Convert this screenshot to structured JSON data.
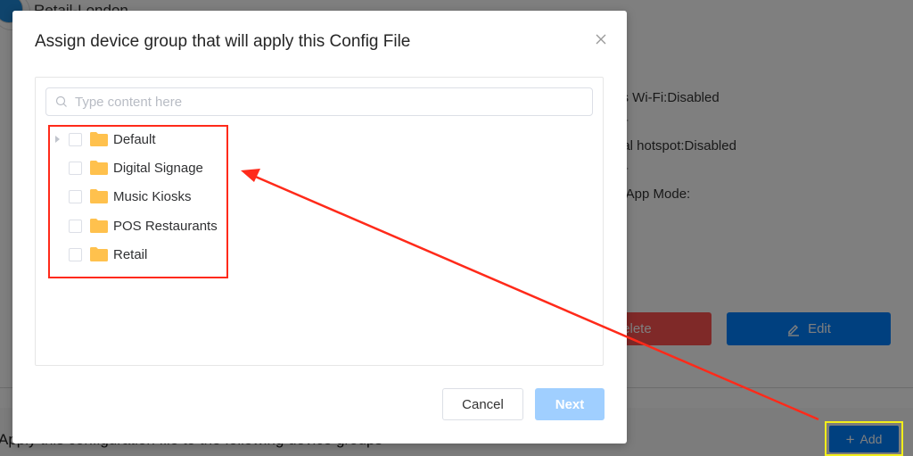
{
  "background_page": {
    "title": "Retail-London",
    "fields": [
      "ss Wi-Fi:Disabled",
      "---",
      "nal hotspot:Disabled",
      "---",
      "e App Mode:"
    ],
    "delete_label": "Delete",
    "edit_label": "Edit",
    "footer_text": "Apply this configuration file to the following device groups",
    "add_label": "Add",
    "colors": {
      "delete": "#ff5350",
      "edit": "#0081ff",
      "add": "#0081ff"
    }
  },
  "modal": {
    "title": "Assign device group that will apply this Config File",
    "search": {
      "placeholder": "Type content here",
      "value": ""
    },
    "tree": [
      {
        "label": "Default",
        "expandable": true,
        "checked": false,
        "icon": "folder-icon"
      },
      {
        "label": "Digital Signage",
        "expandable": false,
        "checked": false,
        "icon": "folder-icon"
      },
      {
        "label": "Music Kiosks",
        "expandable": false,
        "checked": false,
        "icon": "folder-icon"
      },
      {
        "label": "POS Restaurants",
        "expandable": false,
        "checked": false,
        "icon": "folder-icon"
      },
      {
        "label": "Retail",
        "expandable": false,
        "checked": false,
        "icon": "folder-icon"
      }
    ],
    "cancel_label": "Cancel",
    "next_label": "Next",
    "next_disabled": true,
    "colors": {
      "next_disabled": "#a0cfff",
      "folder": "#ffc14d"
    }
  },
  "annotations": {
    "highlight_group_list": "red-box",
    "highlight_add_button": "yellow-box",
    "arrow": "from add button to group list",
    "colors": {
      "red": "#ff2a1a",
      "yellow": "#f2ee1a"
    }
  }
}
